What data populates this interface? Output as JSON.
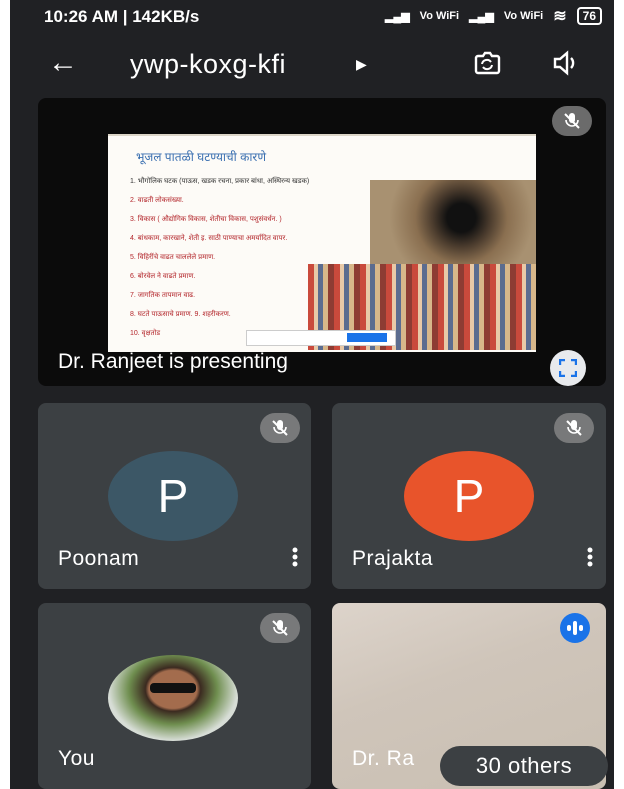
{
  "status_bar": {
    "time_speed": "10:26 AM | 142KB/s",
    "battery": "76",
    "network_labels": [
      "Vo WiFi",
      "Vo WiFi"
    ]
  },
  "header": {
    "meeting_code": "ywp-koxg-kfi"
  },
  "presentation": {
    "presenting_label": "Dr. Ranjeet is presenting",
    "slide": {
      "title": "भूजल पातळी घटण्याची कारणे",
      "items": [
        "1. भौगोलिक घटक (पाऊस, खडक रचना, प्रकार बांधा, अस्थिरन्य खडक)",
        "2. वाढती लोकसंख्या.",
        "3. विकास ( औद्योगिक विकास, शेतीचा विकास, पशुसंवर्धन. )",
        "4. बांधकाम, कारखाने, शेती इ. साठी पाण्याचा अमर्यादित वापर.",
        "5. विहिरींचे वाढत चाललेले प्रमाण.",
        "6. बोरवेल ने वाढते प्रमाण.",
        "7. जागतिक तापमान वाढ.",
        "8. घटते पाऊसाचे प्रमाण.    9. शहरीकरण.",
        "10. वृक्षतोड"
      ]
    }
  },
  "participants": [
    {
      "name": "Poonam",
      "initial": "P",
      "color": "#3c5766"
    },
    {
      "name": "Prajakta",
      "initial": "P",
      "color": "#e8542b"
    },
    {
      "name": "You"
    },
    {
      "name": "Dr. Ra"
    }
  ],
  "others_pill": "30 others",
  "colors": {
    "background": "#202124",
    "tile": "#3c4043",
    "speaking_accent": "#1a73e8"
  }
}
